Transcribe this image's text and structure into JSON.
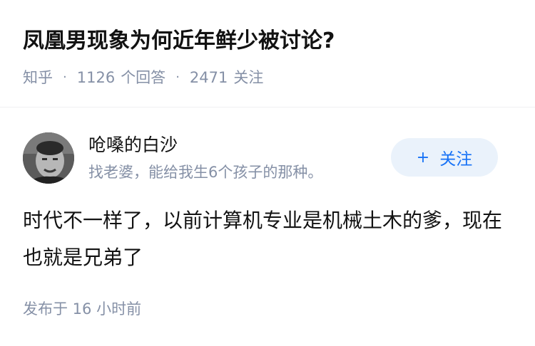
{
  "question": {
    "title": "凤凰男现象为何近年鲜少被讨论?",
    "site": "知乎",
    "answer_count": "1126",
    "answer_label": "个回答",
    "follower_count": "2471",
    "follower_label": "关注"
  },
  "answer": {
    "author": {
      "name": "呛嗓的白沙",
      "bio": "找老婆，能给我生6个孩子的那种。",
      "avatar_icon": "person-photo-avatar"
    },
    "follow_button": {
      "label": "关注",
      "icon": "plus-icon",
      "color": "#1772f6",
      "background": "#eaf2fb"
    },
    "content": "时代不一样了，以前计算机专业是机械土木的爹，现在也就是兄弟了",
    "published": "发布于 16 小时前"
  },
  "colors": {
    "text": "#121212",
    "meta": "#8590a6",
    "divider": "#f0f0f2"
  }
}
